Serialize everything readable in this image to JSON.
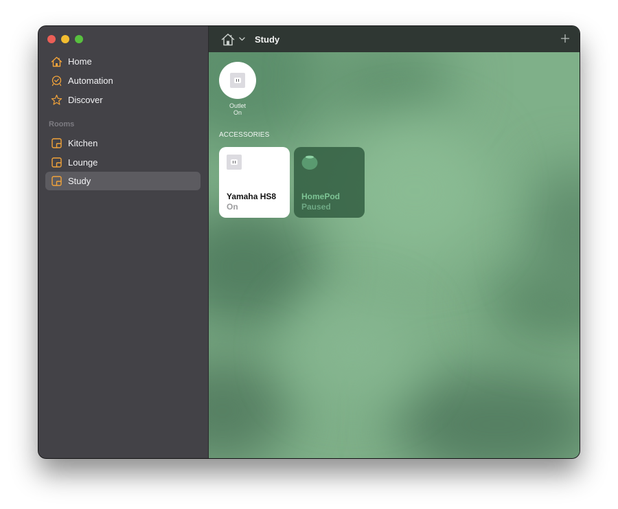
{
  "window": {
    "traffic_lights": [
      "close",
      "minimize",
      "zoom"
    ]
  },
  "sidebar": {
    "items": [
      {
        "label": "Home",
        "icon": "house-icon"
      },
      {
        "label": "Automation",
        "icon": "clock-icon"
      },
      {
        "label": "Discover",
        "icon": "star-icon"
      }
    ],
    "rooms_header": "Rooms",
    "rooms": [
      {
        "label": "Kitchen",
        "icon": "room-icon"
      },
      {
        "label": "Lounge",
        "icon": "room-icon"
      },
      {
        "label": "Study",
        "icon": "room-icon",
        "selected": true
      }
    ],
    "accent_color": "#f2a33a"
  },
  "toolbar": {
    "home_icon": "house-icon",
    "menu_icon": "chevron-down-icon",
    "title": "Study",
    "add_icon": "plus-icon"
  },
  "main": {
    "favorites": [
      {
        "name": "Outlet",
        "status": "On",
        "icon": "outlet-icon"
      }
    ],
    "accessories_header": "ACCESSORIES",
    "accessories": [
      {
        "name": "Yamaha HS8",
        "status": "On",
        "icon": "outlet-icon",
        "active": true
      },
      {
        "name": "HomePod",
        "status": "Paused",
        "icon": "homepod-icon",
        "active": false
      }
    ],
    "background_color": "#7fb089"
  }
}
